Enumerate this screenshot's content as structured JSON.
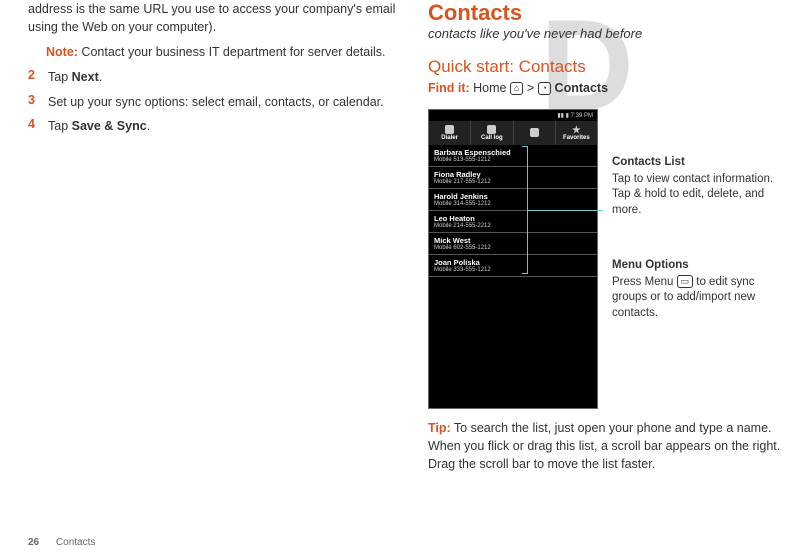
{
  "left": {
    "intro": "address is the same URL you use to access your company's email using the Web on your computer).",
    "noteLabel": "Note:",
    "noteText": " Contact your business IT department for server details.",
    "step2num": "2",
    "step2a": "Tap ",
    "step2b": "Next",
    "step2c": ".",
    "step3num": "3",
    "step3": "Set up your sync options: select email, contacts, or calendar.",
    "step4num": "4",
    "step4a": "Tap ",
    "step4b": "Save & Sync",
    "step4c": "."
  },
  "right": {
    "title": "Contacts",
    "subtitle": "contacts like you've never had before",
    "section": "Quick start: Contacts",
    "findLabel": "Find it:",
    "findText1": " Home ",
    "homeIcon": "⌂",
    "gt": " > ",
    "contactsIcon": "◔",
    "findText2": " Contacts",
    "phone": {
      "time": "7:39 PM",
      "tabs": [
        "Dialer",
        "Call log",
        "",
        "Favorites"
      ],
      "items": [
        {
          "name": "Barbara Espenschied",
          "sub": "Mobile 513-555-1212"
        },
        {
          "name": "Fiona Radley",
          "sub": "Mobile 217-555-1212"
        },
        {
          "name": "Harold Jenkins",
          "sub": "Mobile 314-555-1212"
        },
        {
          "name": "Leo Heaton",
          "sub": "Mobile 214-555-2212"
        },
        {
          "name": "Mick West",
          "sub": "Mobile 602-555-1212"
        },
        {
          "name": "Joan Poliska",
          "sub": "Mobile 333-555-1212"
        }
      ]
    },
    "callouts": {
      "cl1t": "Contacts  List",
      "cl1b": "Tap to view contact information. Tap & hold to edit, delete, and more.",
      "cl2t": "Menu Options",
      "cl2a": "Press Menu ",
      "menuIcon": "▭",
      "cl2b": " to edit sync groups or to add/import new contacts."
    },
    "tipLabel": "Tip:",
    "tipText": " To search the list, just open your phone and type a name. When you flick or drag this list, a scroll bar appears on the right. Drag the scroll bar to move the list faster."
  },
  "footer": {
    "page": "26",
    "section": "Contacts"
  }
}
